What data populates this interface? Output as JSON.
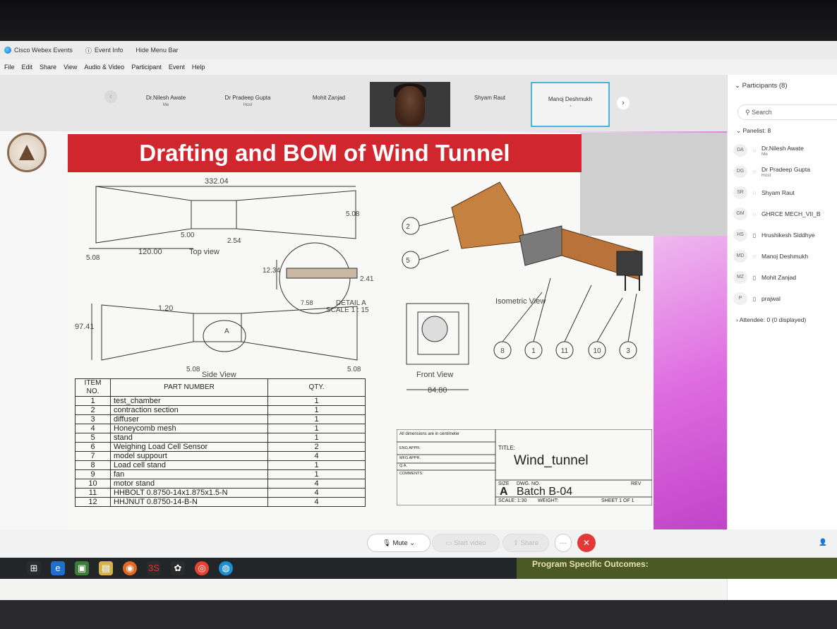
{
  "window": {
    "app_title": "Cisco Webex Events",
    "event_info": "Event Info",
    "hide_menu": "Hide Menu Bar"
  },
  "menu": [
    "File",
    "Edit",
    "Share",
    "View",
    "Audio & Video",
    "Participant",
    "Event",
    "Help"
  ],
  "video_strip": {
    "tiles": [
      {
        "name": "Dr.Nilesh Awate",
        "sub": "Me"
      },
      {
        "name": "Dr Pradeep Gupta",
        "sub": "Host"
      },
      {
        "name": "Mohit Zanjad",
        "sub": ""
      },
      {
        "name": "",
        "sub": ""
      },
      {
        "name": "Shyam Raut",
        "sub": ""
      },
      {
        "name": "Manoj Deshmukh",
        "sub": ""
      }
    ]
  },
  "slide": {
    "title": "Drafting and BOM of Wind Tunnel",
    "top_view": {
      "length": "332.04",
      "dims": [
        "5.08",
        "120.00",
        "5.00",
        "2.54",
        "5.08"
      ],
      "label": "Top view"
    },
    "detail": {
      "dims": [
        "12.34",
        "2.41",
        "7.58"
      ],
      "label": "DETAIL A",
      "scale": "SCALE 1 : 15"
    },
    "side_view": {
      "dims": [
        "97.41",
        "1.20",
        "5.08",
        "5.08"
      ],
      "label": "Side View",
      "detail_marker": "A"
    },
    "front_view": {
      "label": "Front View",
      "width": "84.80"
    },
    "isometric_view": {
      "label": "Isometric View",
      "balloons": [
        "2",
        "5",
        "8",
        "1",
        "11",
        "10",
        "3"
      ]
    },
    "bom": {
      "headers": [
        "ITEM NO.",
        "PART NUMBER",
        "QTY."
      ],
      "rows": [
        [
          "1",
          "test_chamber",
          "1"
        ],
        [
          "2",
          "contraction section",
          "1"
        ],
        [
          "3",
          "diffuser",
          "1"
        ],
        [
          "4",
          "Honeycomb mesh",
          "1"
        ],
        [
          "5",
          "stand",
          "1"
        ],
        [
          "6",
          "Weighing Load Cell Sensor",
          "2"
        ],
        [
          "7",
          "model suppourt",
          "4"
        ],
        [
          "8",
          "Load cell stand",
          "1"
        ],
        [
          "9",
          "fan",
          "1"
        ],
        [
          "10",
          "motor stand",
          "4"
        ],
        [
          "11",
          "HHBOLT 0.8750-14x1.875x1.5-N",
          "4"
        ],
        [
          "12",
          "HHJNUT 0.8750-14-B-N",
          "4"
        ]
      ]
    },
    "title_block": {
      "note": "All dimensions are in centimeter",
      "fields": [
        "ENG APPR.",
        "MFG APPR.",
        "Q.A.",
        "COMMENTS:"
      ],
      "title_label": "TITLE:",
      "title": "Wind_tunnel",
      "size_label": "SIZE",
      "size": "A",
      "dwg_label": "DWG. NO.",
      "dwg_no": "Batch B-04",
      "rev_label": "REV",
      "scale": "SCALE: 1:30",
      "weight": "WEIGHT:",
      "sheet": "SHEET 1 OF 1"
    }
  },
  "participants": {
    "header": "Participants (8)",
    "search_placeholder": "Search",
    "panelist_header": "Panelist: 8",
    "list": [
      {
        "initials": "DA",
        "name": "Dr.Nilesh Awate",
        "sub": "Me",
        "icon": "mic-icon"
      },
      {
        "initials": "DG",
        "name": "Dr Pradeep Gupta",
        "sub": "Host",
        "icon": "mic-icon"
      },
      {
        "initials": "SR",
        "name": "Shyam Raut",
        "sub": "",
        "icon": "mic-icon"
      },
      {
        "initials": "GM",
        "name": "GHRCE MECH_VII_B",
        "sub": "",
        "icon": "mic-icon"
      },
      {
        "initials": "HS",
        "name": "Hrushikesh Siddhye",
        "sub": "",
        "icon": "phone-icon"
      },
      {
        "initials": "MD",
        "name": "Manoj Deshmukh",
        "sub": "",
        "icon": "mic-icon"
      },
      {
        "initials": "MZ",
        "name": "Mohit Zanjad",
        "sub": "",
        "icon": "phone-icon"
      },
      {
        "initials": "P",
        "name": "prajwal",
        "sub": "",
        "icon": "phone-icon"
      }
    ],
    "attendee_header": "Attendee: 0 (0 displayed)"
  },
  "controls": {
    "mute": "Mute",
    "start_video": "Start video",
    "share": "Share",
    "more": "···",
    "end": "✕"
  },
  "taskbar": {
    "program_outcomes": "Program Specific Outcomes:"
  }
}
